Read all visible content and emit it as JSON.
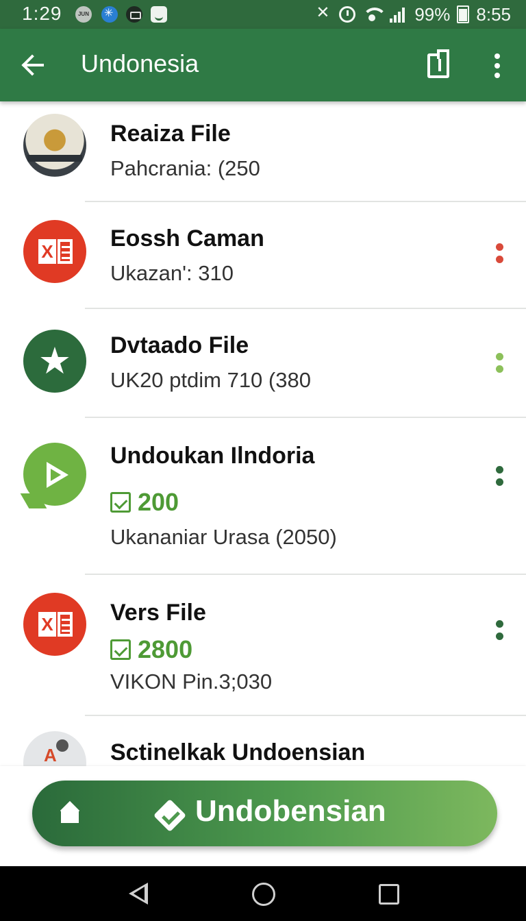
{
  "status_bar": {
    "left_time": "1:29",
    "right_time": "8:55",
    "battery": "99%",
    "notification_label": "JUN"
  },
  "app_bar": {
    "title": "Undonesia"
  },
  "list": {
    "items": [
      {
        "title": "Reaiza File",
        "subtitle": "Pahcrania: (250",
        "avatar": "emblem"
      },
      {
        "title": "Eossh Caman",
        "subtitle": "Ukazan': 310",
        "avatar": "excel-icon",
        "menu_color": "#d94a3a"
      },
      {
        "title": "Dvtaado File",
        "subtitle": "UK20 ptdim 710 (380",
        "avatar": "star-icon",
        "menu_color": "#8cc05a"
      },
      {
        "title": "Undoukan Ilndoria",
        "count": "200",
        "subtitle": "Ukananiar Urasa (2050)",
        "avatar": "play-bubble-icon",
        "menu_color": "#2f6a3d"
      },
      {
        "title": "Vers File",
        "count": "2800",
        "subtitle": "VIKON Pin.3;030",
        "avatar": "excel-icon",
        "menu_color": "#2f6a3d"
      },
      {
        "title": "Sctinelkak Undoensian",
        "avatar": "generic-app-icon"
      }
    ]
  },
  "bottom_bar": {
    "label": "Undobensian"
  },
  "colors": {
    "primary": "#2f7a45",
    "status_bar": "#2f6a3d",
    "accent_green": "#4e9a35"
  }
}
